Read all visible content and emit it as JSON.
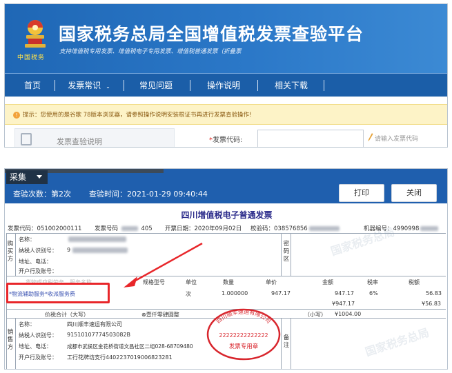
{
  "portal": {
    "title": "国家税务总局全国增值税发票查验平台",
    "subtitle": "支持增值税专用发票、增值税电子专用发票、增值税普通发票（折叠票",
    "emblem_caption": "中国税务",
    "nav": [
      "首页",
      "发票常识",
      "常见问题",
      "操作说明",
      "相关下载"
    ],
    "notice": "提示：您使用的是谷歌 78版本浏览器，请参照操作说明安装根证书再进行发票查验操作!",
    "form_left_label": "发票查验说明",
    "code_label": "发票代码:",
    "code_placeholder": "请输入发票代码"
  },
  "result": {
    "caiji": "采集",
    "check_count": "查验次数：第2次",
    "check_time": "查验时间：2021-01-29 09:40:44",
    "print_label": "打印",
    "close_label": "关闭",
    "invoice_title": "四川增值税电子普通发票",
    "meta": {
      "code": "发票代码：051002000111",
      "number_label": "发票号码",
      "number_tail": "405",
      "date": "开票日期：2020年09月02日",
      "check_code": "校验码：0385768",
      "check_code_tail": "56",
      "machine": "机器编号：4990998"
    },
    "buyer": {
      "side_label": "购买方",
      "name": "名称：",
      "tax_id": "纳税人识别号：",
      "tax_id_tail": "9",
      "address": "地址、电话：",
      "bank": "开户行及账号："
    },
    "password_area_label": "密码区",
    "items": {
      "header_name": "货物或应税劳务、服务名称",
      "header_spec": "规格型号",
      "header_unit": "单位",
      "header_qty": "数量",
      "header_price": "单价",
      "header_amount": "金额",
      "header_rate": "税率",
      "header_tax": "税额",
      "name": "*物流辅助服务*收派服务费",
      "unit": "次",
      "qty": "1.000000",
      "price": "947.17",
      "amount": "947.17",
      "rate": "6%",
      "tax": "56.83",
      "amount_total": "¥947.17",
      "tax_total": "¥56.83"
    },
    "total": {
      "label": "价税合计（大写）",
      "upper": "⊗壹仟零肆圆整",
      "lower_label": "（小写）",
      "lower": "¥1004.00"
    },
    "seller": {
      "side_label": "销售方",
      "name": "名称：",
      "name_value": "四川顺丰速运有限公司",
      "tax_id": "纳税人识别号：",
      "tax_id_value": "91510107774503082B",
      "address": "地址、电话：",
      "address_value": "成都市武侯区金花桥街道文昌社区二组028-68709480",
      "bank": "开户行及账号：",
      "bank_value": "工行花牌坊支行4402237019006823281"
    },
    "remarks_label": "备注",
    "stamp": {
      "top_text": "四川顺丰速运有限公司",
      "number": "22222222222222",
      "bottom_text": "发票专用章"
    },
    "watermark": "国家税务总局"
  },
  "colors": {
    "banner_blue": "#2b78c8",
    "nav_blue": "#1b5ea8",
    "header_blue": "#1f5fae",
    "annotation_red": "#e8262a",
    "stamp_red": "#d8262d",
    "title_blue": "#2a2a8a"
  }
}
